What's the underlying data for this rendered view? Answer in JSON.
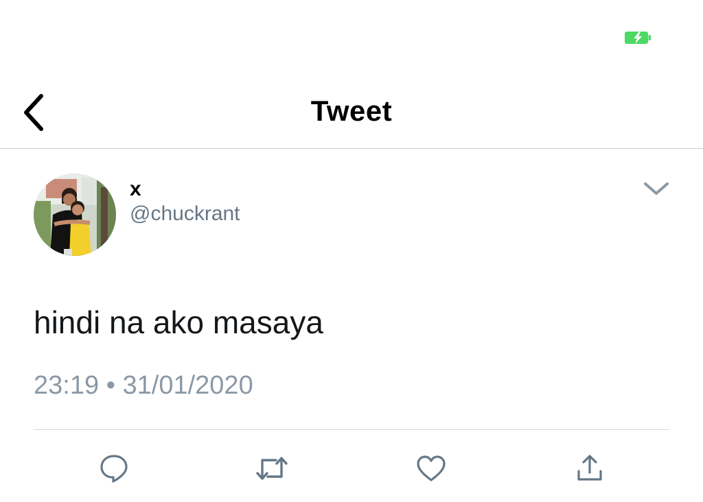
{
  "status_bar": {
    "battery_icon": "battery-charging-icon",
    "battery_color": "#4cd964"
  },
  "nav": {
    "title": "Tweet",
    "back_icon": "chevron-left-icon"
  },
  "tweet": {
    "author": {
      "display_name": "x",
      "handle": "@chuckrant"
    },
    "text": "hindi na ako masaya",
    "timestamp": "23:19 • 31/01/2020",
    "more_icon": "chevron-down-icon"
  },
  "actions": [
    {
      "name": "reply",
      "icon": "reply-bubble-icon"
    },
    {
      "name": "retweet",
      "icon": "retweet-icon"
    },
    {
      "name": "like",
      "icon": "heart-icon"
    },
    {
      "name": "share",
      "icon": "share-upload-icon"
    }
  ],
  "colors": {
    "icon_gray": "#657786",
    "secondary_text": "#8b98a5",
    "divider": "#d3d8dc"
  }
}
